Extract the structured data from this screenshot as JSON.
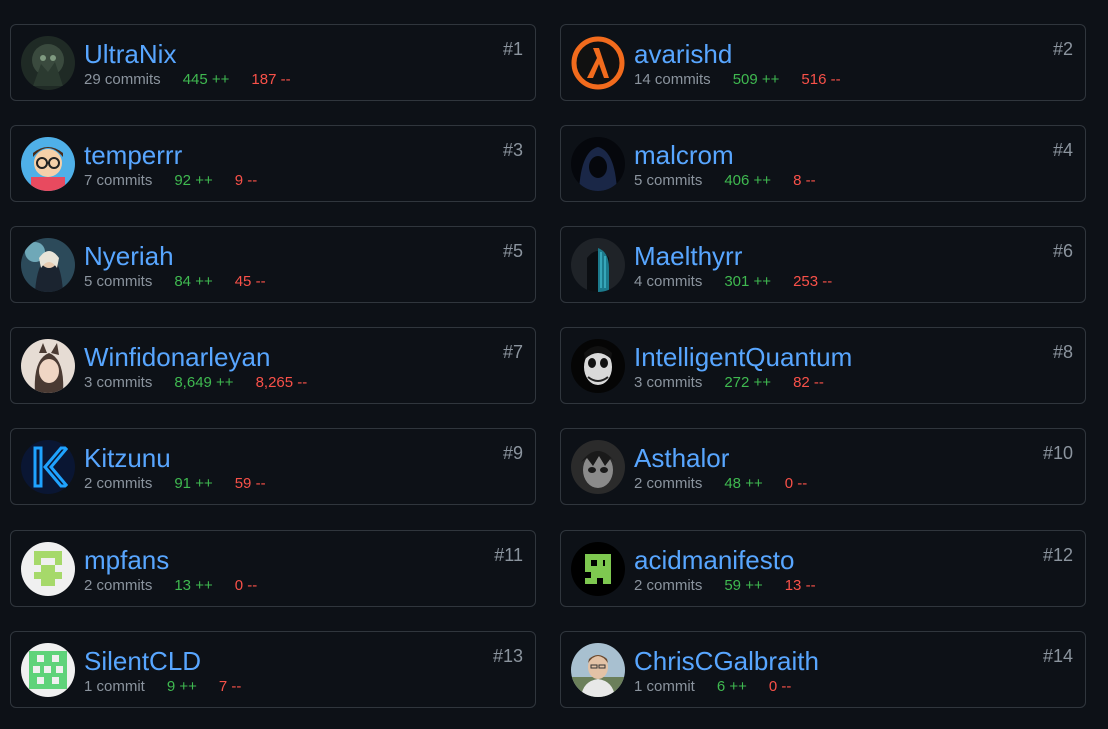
{
  "contributors": [
    {
      "rank": "#1",
      "name": "UltraNix",
      "commits": "29 commits",
      "additions": "445 ++",
      "deletions": "187 --",
      "avatar": "dark-creature-avatar"
    },
    {
      "rank": "#2",
      "name": "avarishd",
      "commits": "14 commits",
      "additions": "509 ++",
      "deletions": "516 --",
      "avatar": "half-life-lambda-avatar"
    },
    {
      "rank": "#3",
      "name": "temperrr",
      "commits": "7 commits",
      "additions": "92 ++",
      "deletions": "9 --",
      "avatar": "cartoon-glasses-avatar"
    },
    {
      "rank": "#4",
      "name": "malcrom",
      "commits": "5 commits",
      "additions": "406 ++",
      "deletions": "8 --",
      "avatar": "hooded-figure-avatar"
    },
    {
      "rank": "#5",
      "name": "Nyeriah",
      "commits": "5 commits",
      "additions": "84 ++",
      "deletions": "45 --",
      "avatar": "fantasy-character-avatar"
    },
    {
      "rank": "#6",
      "name": "Maelthyrr",
      "commits": "4 commits",
      "additions": "301 ++",
      "deletions": "253 --",
      "avatar": "matrix-face-avatar"
    },
    {
      "rank": "#7",
      "name": "Winfidonarleyan",
      "commits": "3 commits",
      "additions": "8,649 ++",
      "deletions": "8,265 --",
      "avatar": "anime-catgirl-avatar"
    },
    {
      "rank": "#8",
      "name": "IntelligentQuantum",
      "commits": "3 commits",
      "additions": "272 ++",
      "deletions": "82 --",
      "avatar": "joker-avatar"
    },
    {
      "rank": "#9",
      "name": "Kitzunu",
      "commits": "2 commits",
      "additions": "91 ++",
      "deletions": "59 --",
      "avatar": "k-logo-avatar"
    },
    {
      "rank": "#10",
      "name": "Asthalor",
      "commits": "2 commits",
      "additions": "48 ++",
      "deletions": "0 --",
      "avatar": "anime-sketch-avatar"
    },
    {
      "rank": "#11",
      "name": "mpfans",
      "commits": "2 commits",
      "additions": "13 ++",
      "deletions": "0 --",
      "avatar": "identicon-green-avatar"
    },
    {
      "rank": "#12",
      "name": "acidmanifesto",
      "commits": "2 commits",
      "additions": "59 ++",
      "deletions": "13 --",
      "avatar": "pixel-creature-avatar"
    },
    {
      "rank": "#13",
      "name": "SilentCLD",
      "commits": "1 commit",
      "additions": "9 ++",
      "deletions": "7 --",
      "avatar": "identicon-checker-avatar"
    },
    {
      "rank": "#14",
      "name": "ChrisCGalbraith",
      "commits": "1 commit",
      "additions": "6 ++",
      "deletions": "0 --",
      "avatar": "photo-man-avatar"
    }
  ],
  "colors": {
    "background": "#0d1117",
    "border": "#30363d",
    "name": "#58a6ff",
    "muted": "#8b949e",
    "additions": "#3fb950",
    "deletions": "#f85149"
  }
}
